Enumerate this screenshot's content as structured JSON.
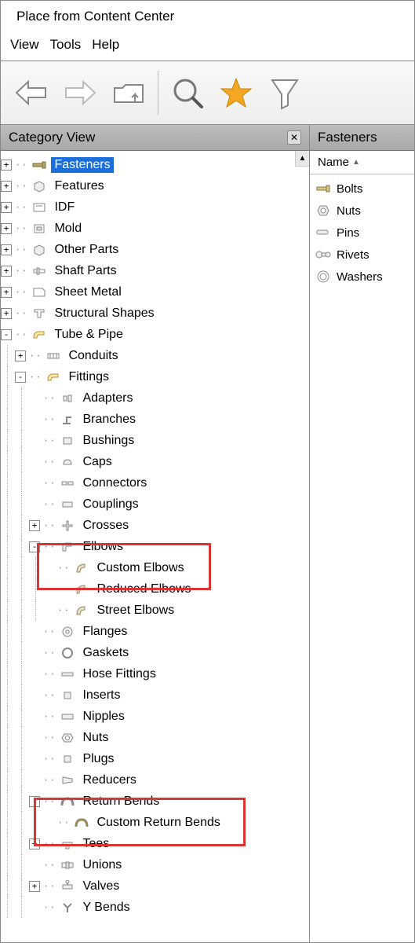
{
  "window": {
    "title": "Place from Content Center"
  },
  "menu": {
    "view": "View",
    "tools": "Tools",
    "help": "Help"
  },
  "toolbar_icons": {
    "back": "back-arrow",
    "forward": "forward-arrow",
    "up": "folder-up",
    "search": "search",
    "favorite": "star",
    "filter": "funnel"
  },
  "left": {
    "title": "Category View",
    "tree": {
      "fasteners": "Fasteners",
      "features": "Features",
      "idf": "IDF",
      "mold": "Mold",
      "other_parts": "Other Parts",
      "shaft_parts": "Shaft Parts",
      "sheet_metal": "Sheet Metal",
      "structural_shapes": "Structural Shapes",
      "tube_pipe": "Tube & Pipe",
      "conduits": "Conduits",
      "fittings": "Fittings",
      "adapters": "Adapters",
      "branches": "Branches",
      "bushings": "Bushings",
      "caps": "Caps",
      "connectors": "Connectors",
      "couplings": "Couplings",
      "crosses": "Crosses",
      "elbows": "Elbows",
      "custom_elbows": "Custom Elbows",
      "reduced_elbows": "Reduced Elbows",
      "street_elbows": "Street Elbows",
      "flanges": "Flanges",
      "gaskets": "Gaskets",
      "hose_fittings": "Hose Fittings",
      "inserts": "Inserts",
      "nipples": "Nipples",
      "nuts": "Nuts",
      "plugs": "Plugs",
      "reducers": "Reducers",
      "return_bends": "Return Bends",
      "custom_return_bends": "Custom Return Bends",
      "tees": "Tees",
      "unions": "Unions",
      "valves": "Valves",
      "y_bends": "Y Bends"
    }
  },
  "right": {
    "title": "Fasteners",
    "column": "Name",
    "items": {
      "bolts": "Bolts",
      "nuts": "Nuts",
      "pins": "Pins",
      "rivets": "Rivets",
      "washers": "Washers"
    }
  },
  "colors": {
    "select_bg": "#1a6fd8",
    "star": "#f5a623",
    "highlight": "#d33333"
  }
}
